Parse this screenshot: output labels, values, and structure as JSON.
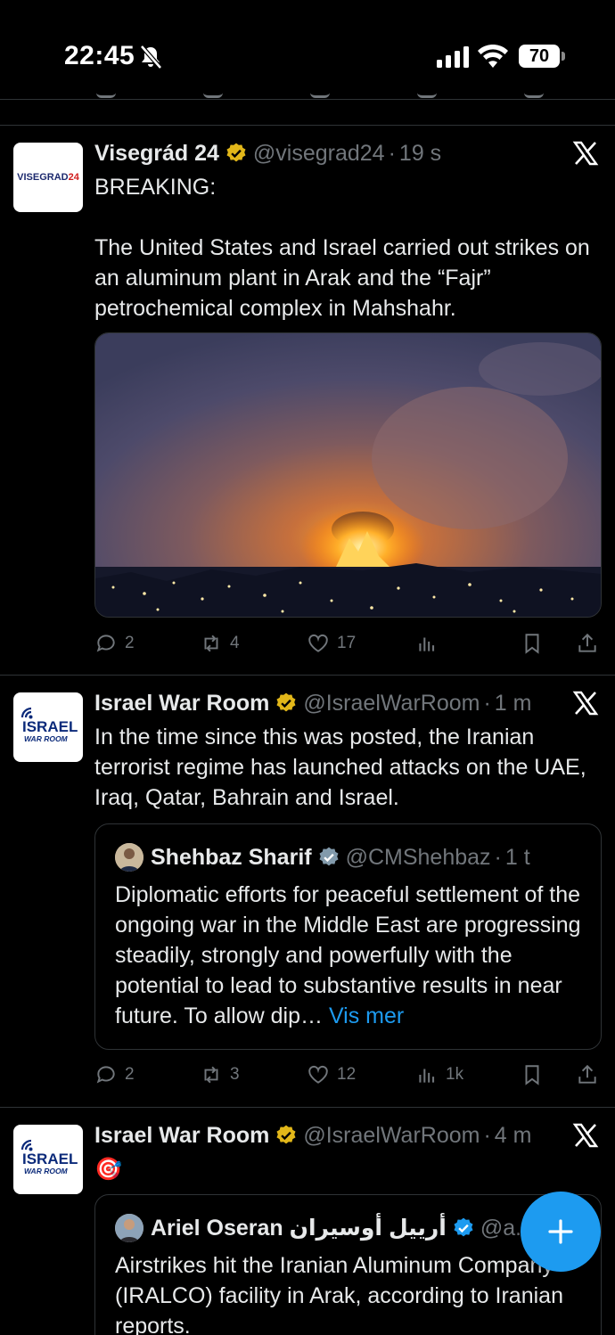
{
  "status_bar": {
    "time": "22:45",
    "battery": "70"
  },
  "tweets": [
    {
      "name": "Visegrád 24",
      "handle": "@visegrad24",
      "time": "19 s",
      "avatar_text": "VISEGRAD",
      "avatar_text_accent": "24",
      "text": "BREAKING:\n\nThe United States and Israel carried out strikes on an aluminum plant in Arak and the “Fajr” petrochemical complex in Mahshahr.",
      "media_icon": "explosion-night-photo",
      "actions": {
        "replies": "2",
        "reposts": "4",
        "likes": "17",
        "views": ""
      }
    },
    {
      "name": "Israel War Room",
      "handle": "@IsraelWarRoom",
      "time": "1 m",
      "avatar_text": "ISRAEL",
      "avatar_subtext": "WAR ROOM",
      "text": "In the time since this was posted, the Iranian terrorist regime has launched attacks on the UAE, Iraq, Qatar, Bahrain and Israel.",
      "quote": {
        "name": "Shehbaz Sharif",
        "handle": "@CMShehbaz",
        "time": "1 t",
        "text": "Diplomatic efforts for peaceful settlement of the ongoing war in the Middle East are progressing steadily, strongly and powerfully with the potential to lead to substantive results in near future. To allow dip…",
        "more": "Vis mer"
      },
      "actions": {
        "replies": "2",
        "reposts": "3",
        "likes": "12",
        "views": "1k"
      }
    },
    {
      "name": "Israel War Room",
      "handle": "@IsraelWarRoom",
      "time": "4 m",
      "avatar_text": "ISRAEL",
      "avatar_subtext": "WAR ROOM",
      "text": "🎯",
      "quote": {
        "name": "Ariel Oseran أرييل أوسيران",
        "handle": "@a...",
        "text": "Airstrikes hit the Iranian Aluminum Company (IRALCO) facility in Arak, according to Iranian reports."
      }
    }
  ],
  "colors": {
    "accent": "#1d9bf0",
    "verified_gold": "#e2b719",
    "verified_blue": "#1d9bf0",
    "muted": "#71767b"
  }
}
